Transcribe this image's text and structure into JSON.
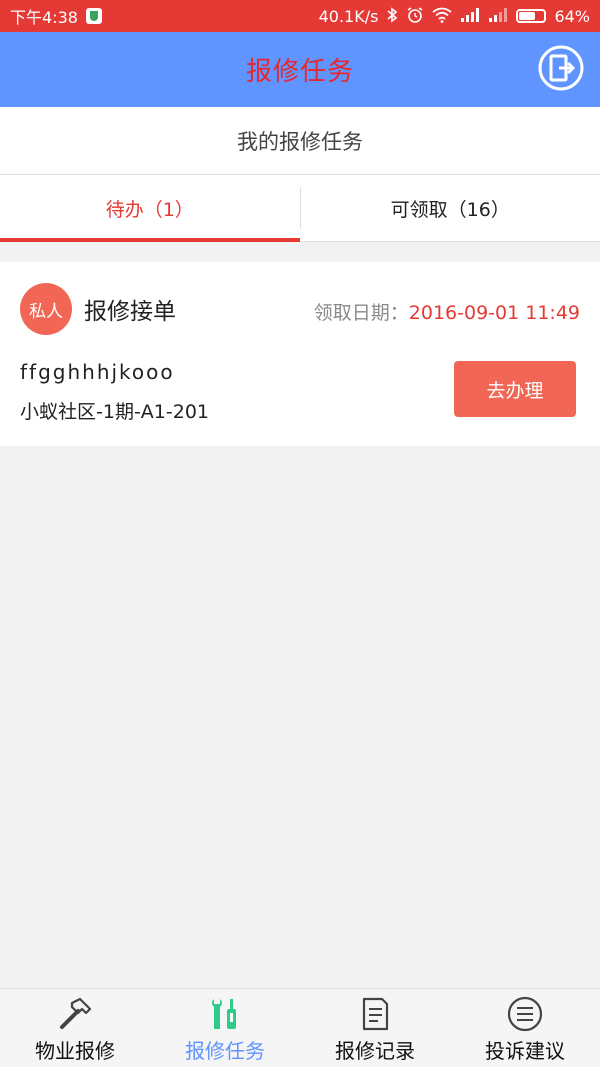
{
  "status_bar": {
    "time": "下午4:38",
    "network_speed": "40.1K/s",
    "battery": "64%",
    "battery_level": 0.64,
    "icons": [
      "shield-icon",
      "bluetooth-icon",
      "alarm-icon",
      "wifi-icon",
      "signal-icon",
      "signal-icon",
      "battery-icon"
    ]
  },
  "header": {
    "title": "报修任务",
    "exit_icon": "exit-door-icon"
  },
  "sub_header": {
    "title": "我的报修任务"
  },
  "tabs": [
    {
      "label": "待办（1）",
      "active": true
    },
    {
      "label": "可领取（16）",
      "active": false
    }
  ],
  "task": {
    "badge": "私人",
    "title": "报修接单",
    "date_label": "领取日期：",
    "date_value": "2016-09-01 11:49",
    "description": "ffgghhhjkooo",
    "address": "小蚁社区-1期-A1-201",
    "action_label": "去办理"
  },
  "bottom_nav": [
    {
      "label": "物业报修",
      "icon": "hammer-icon",
      "active": false
    },
    {
      "label": "报修任务",
      "icon": "tools-icon",
      "active": true
    },
    {
      "label": "报修记录",
      "icon": "document-icon",
      "active": false
    },
    {
      "label": "投诉建议",
      "icon": "list-icon",
      "active": false
    }
  ],
  "colors": {
    "status_bar": "#e53935",
    "title_bar": "#6094ff",
    "title_text": "#e8262d",
    "accent_red": "#e53935",
    "button": "#f16655",
    "active_nav_text": "#6094ff",
    "active_nav_icon": "#2ecc8a"
  }
}
